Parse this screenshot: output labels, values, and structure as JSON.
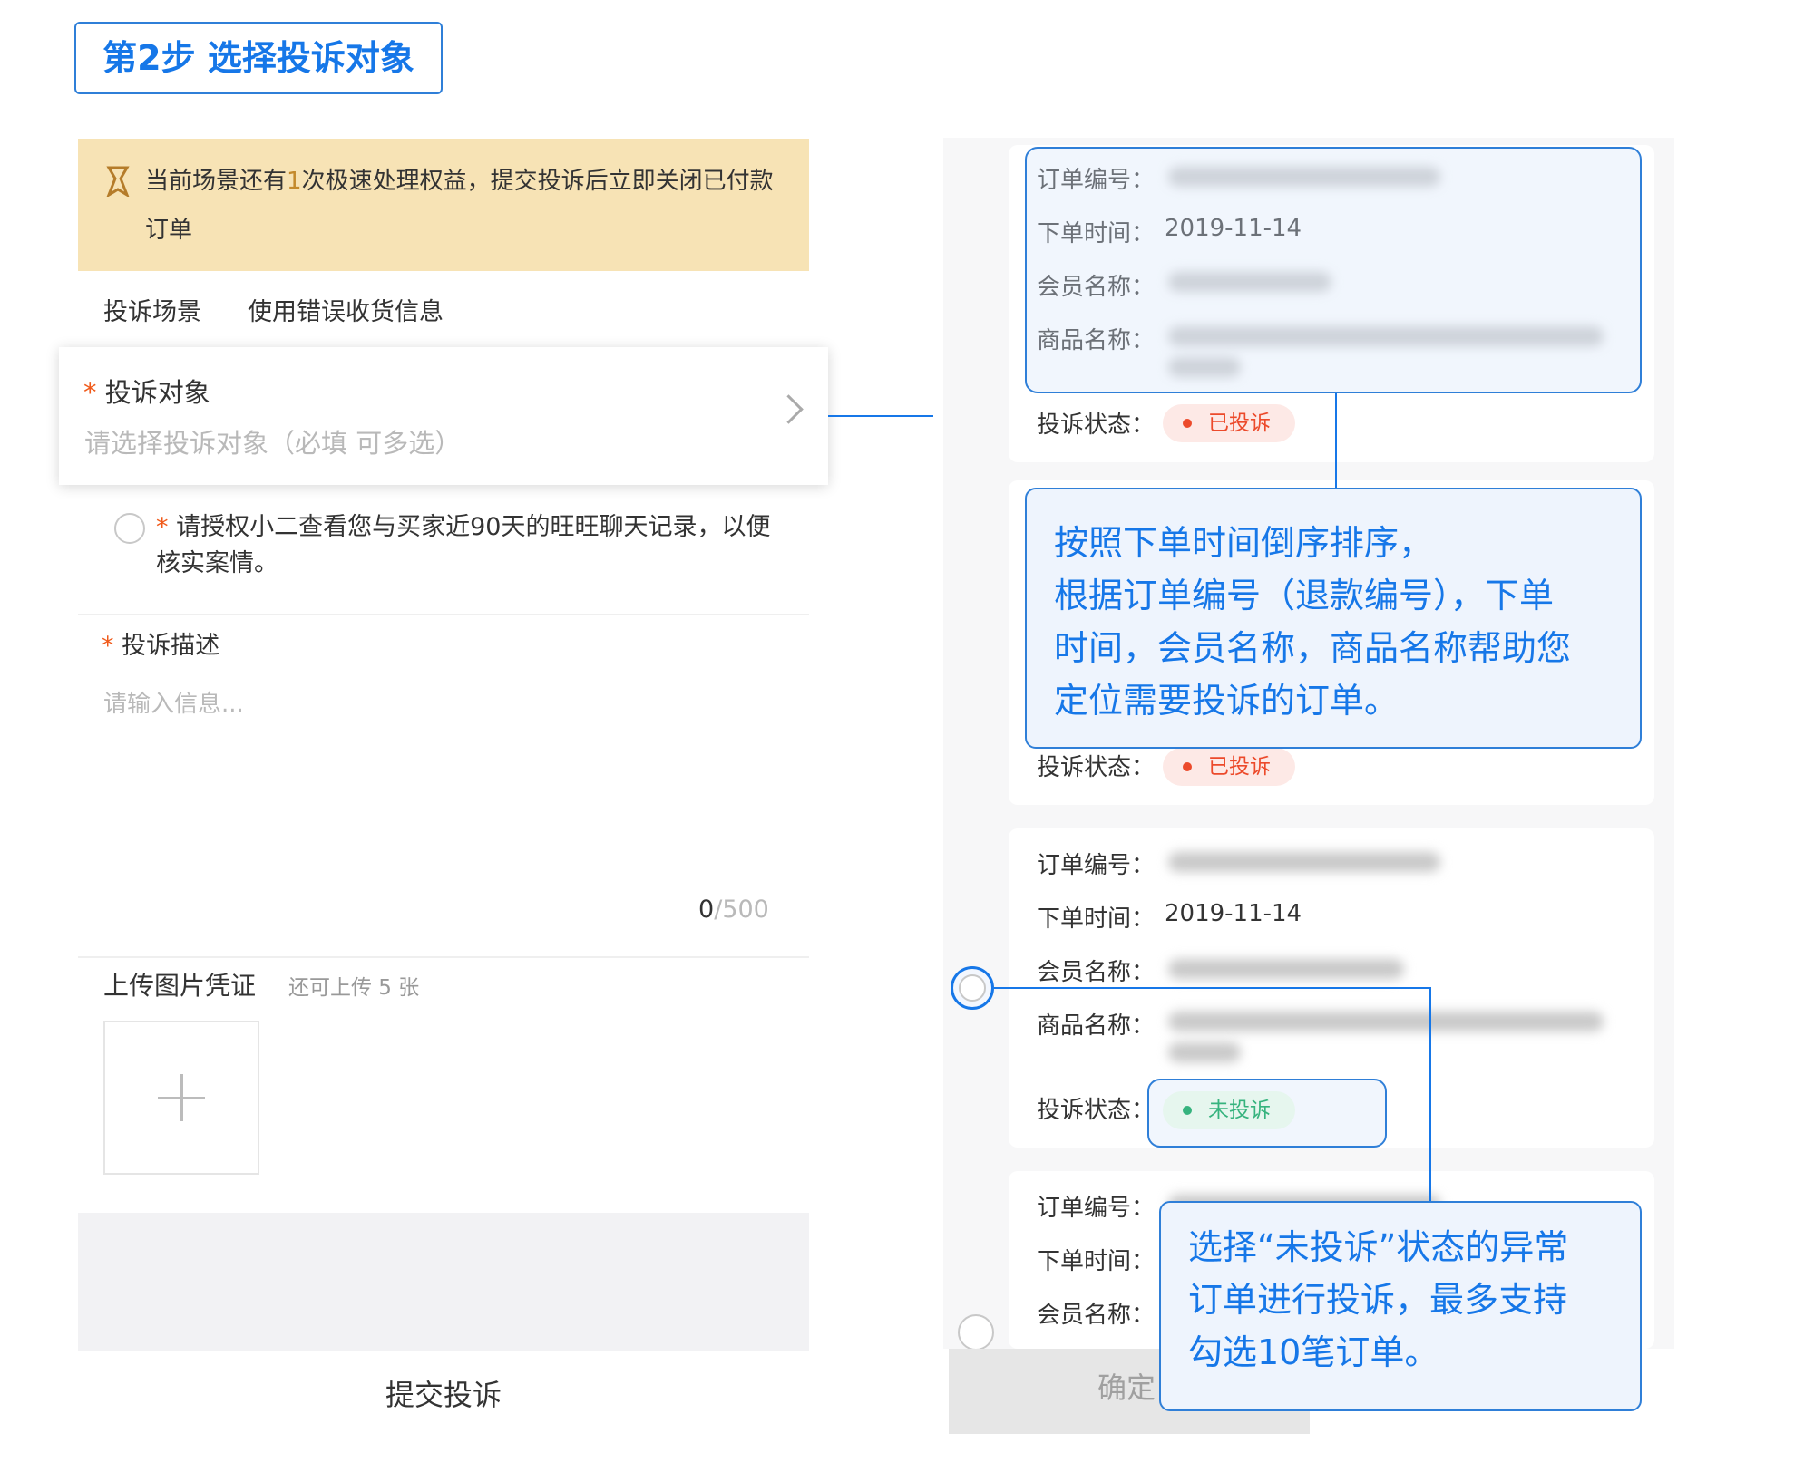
{
  "step_title": "第2步 选择投诉对象",
  "notice": {
    "icon": "badge-icon",
    "text_before": "当前场景还有",
    "count": "1",
    "text_after": "次极速处理权益，提交投诉后立即关闭已付款订单"
  },
  "scene": {
    "label": "投诉场景",
    "value": "使用错误收货信息"
  },
  "target": {
    "required_mark": "*",
    "label": "投诉对象",
    "placeholder": "请选择投诉对象（必填 可多选）"
  },
  "authorization": {
    "required_mark": "*",
    "text": "请授权小二查看您与买家近90天的旺旺聊天记录，以便核实案情。"
  },
  "description": {
    "required_mark": "*",
    "label": "投诉描述",
    "placeholder": "请输入信息...",
    "count": "0",
    "max": "/500"
  },
  "upload": {
    "label": "上传图片凭证",
    "hint": "还可上传 5 张"
  },
  "submit_label": "提交投诉",
  "orders": [
    {
      "order_no_label": "订单编号：",
      "time_label": "下单时间：",
      "time_value": "2019-11-14",
      "member_label": "会员名称：",
      "product_label": "商品名称：",
      "status_label": "投诉状态：",
      "status": "已投诉"
    },
    {
      "status_label": "投诉状态：",
      "status": "已投诉"
    },
    {
      "order_no_label": "订单编号：",
      "time_label": "下单时间：",
      "time_value": "2019-11-14",
      "member_label": "会员名称：",
      "product_label": "商品名称：",
      "status_label": "投诉状态：",
      "status": "未投诉"
    },
    {
      "order_no_label": "订单编号：",
      "time_label": "下单时间：",
      "member_label": "会员名称："
    }
  ],
  "callout_sort": "按照下单时间倒序排序，根据订单编号（退款编号），下单时间，会员名称，商品名称帮助您定位需要投诉的订单。",
  "callout_sort_lines": [
    "按照下单时间倒序排序，",
    "根据订单编号（退款编号），下单",
    "时间，会员名称，商品名称帮助您",
    "定位需要投诉的订单。"
  ],
  "callout_select_lines": [
    "选择“未投诉”状态的异常",
    "订单进行投诉，最多支持",
    "勾选10笔订单。"
  ],
  "confirm_label": "确定",
  "colors": {
    "accent": "#1677e8",
    "notice_bg": "#f7e3b5",
    "status_done": "#ec4a2b",
    "status_pending": "#36b37e"
  }
}
